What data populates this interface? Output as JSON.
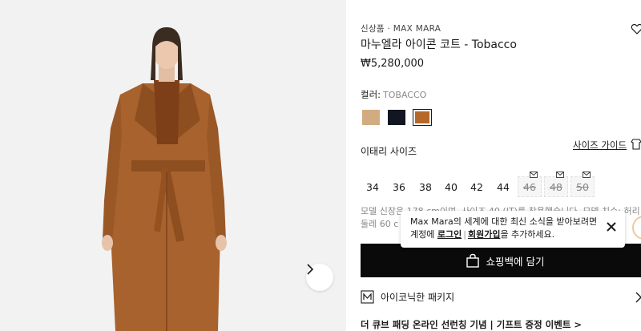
{
  "product": {
    "category": "신상품 · MAX MARA",
    "title": "마누엘라 아이콘 코트 - Tobacco",
    "price": "₩5,280,000"
  },
  "color": {
    "label": "컬러:",
    "value": "TOBACCO",
    "swatches": [
      {
        "name": "camel",
        "hex": "#d2ac80"
      },
      {
        "name": "navy",
        "hex": "#111622"
      },
      {
        "name": "tobacco",
        "hex": "#b4682a",
        "selected": true
      }
    ]
  },
  "size": {
    "label": "이태리 사이즈",
    "guide_label": "사이즈 가이드",
    "options": [
      {
        "label": "34",
        "available": true
      },
      {
        "label": "36",
        "available": true
      },
      {
        "label": "38",
        "available": true
      },
      {
        "label": "40",
        "available": true
      },
      {
        "label": "42",
        "available": true
      },
      {
        "label": "44",
        "available": true
      },
      {
        "label": "46",
        "available": false
      },
      {
        "label": "48",
        "available": false
      },
      {
        "label": "50",
        "available": false
      }
    ]
  },
  "model_info": {
    "line1": "모델 신장은 178 cm이며, 사이즈 40 (IT)를 착용했습니다. 모델 치수: 허리",
    "line2": "둘레 60 c"
  },
  "tooltip": {
    "line1": "Max Mara의 세계에 대한 최신 소식을 받아보려면",
    "prefix": "계정에 ",
    "login": "로그인",
    "divider": "|",
    "signup": "회원가입",
    "suffix": "을 추가하세요."
  },
  "actions": {
    "add_to_bag": "쇼핑백에 담기"
  },
  "package": {
    "label": "아이코닉한 패키지"
  },
  "promo": {
    "text": "더 큐브 패딩 온라인 선런칭 기념 | 기프트 증정 이벤트 >"
  },
  "colors": {
    "coat": "#a8622d",
    "coat_dark": "#7d431c",
    "button_bg": "#0a0a0a"
  }
}
